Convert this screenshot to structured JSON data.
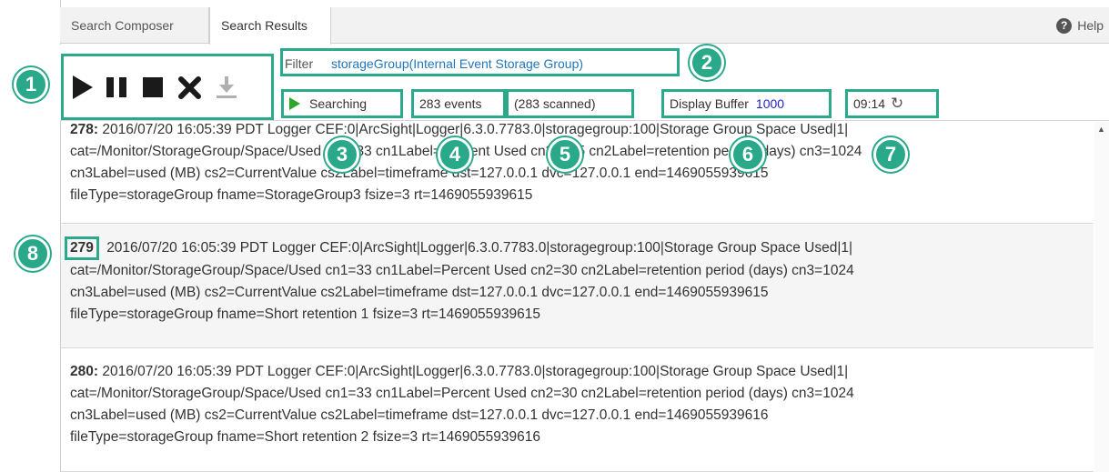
{
  "tabs": [
    {
      "label": "Search Composer"
    },
    {
      "label": "Search Results"
    }
  ],
  "help": {
    "label": "Help",
    "icon": "question-icon"
  },
  "controls": {
    "icons": [
      "play-icon",
      "pause-icon",
      "stop-icon",
      "close-icon",
      "download-icon"
    ]
  },
  "filter": {
    "label": "Filter",
    "value": "storageGroup(Internal Event Storage Group)"
  },
  "status": {
    "searching": "Searching",
    "events": "283 events",
    "scanned": "(283 scanned)",
    "buffer_label": "Display Buffer",
    "buffer_value": "1000",
    "time": "09:14"
  },
  "badges": [
    "1",
    "2",
    "3",
    "4",
    "5",
    "6",
    "7",
    "8"
  ],
  "events": [
    {
      "num": "278",
      "sep": ":",
      "lines": [
        "2016/07/20 16:05:39 PDT   Logger   CEF:0|ArcSight|Logger|6.3.0.7783.0|storagegroup:100|Storage Group Space Used|1|",
        "cat=/Monitor/StorageGroup/Space/Used cn1=33 cn1Label=Percent Used cn2=365 cn2Label=retention period (days) cn3=1024",
        "cn3Label=used (MB) cs2=CurrentValue cs2Label=timeframe dst=127.0.0.1 dvc=127.0.0.1 end=1469055939615",
        "fileType=storageGroup fname=StorageGroup3 fsize=3 rt=1469055939615"
      ]
    },
    {
      "num": "279",
      "sep": "",
      "lines": [
        "2016/07/20 16:05:39 PDT   Logger   CEF:0|ArcSight|Logger|6.3.0.7783.0|storagegroup:100|Storage Group Space Used|1|",
        "cat=/Monitor/StorageGroup/Space/Used cn1=33 cn1Label=Percent Used cn2=30 cn2Label=retention period (days) cn3=1024",
        "cn3Label=used (MB) cs2=CurrentValue cs2Label=timeframe dst=127.0.0.1 dvc=127.0.0.1 end=1469055939615",
        "fileType=storageGroup fname=Short retention 1 fsize=3 rt=1469055939615"
      ]
    },
    {
      "num": "280",
      "sep": ":",
      "lines": [
        "2016/07/20 16:05:39 PDT   Logger   CEF:0|ArcSight|Logger|6.3.0.7783.0|storagegroup:100|Storage Group Space Used|1|",
        "cat=/Monitor/StorageGroup/Space/Used cn1=33 cn1Label=Percent Used cn2=30 cn2Label=retention period (days) cn3=1024",
        "cn3Label=used (MB) cs2=CurrentValue cs2Label=timeframe dst=127.0.0.1 dvc=127.0.0.1 end=1469055939616",
        "fileType=storageGroup fname=Short retention 2 fsize=3 rt=1469055939616"
      ]
    }
  ],
  "colors": {
    "accent": "#2aaa8a",
    "link": "#2277bb",
    "buffer": "#2222cc",
    "play": "#2da82d"
  }
}
